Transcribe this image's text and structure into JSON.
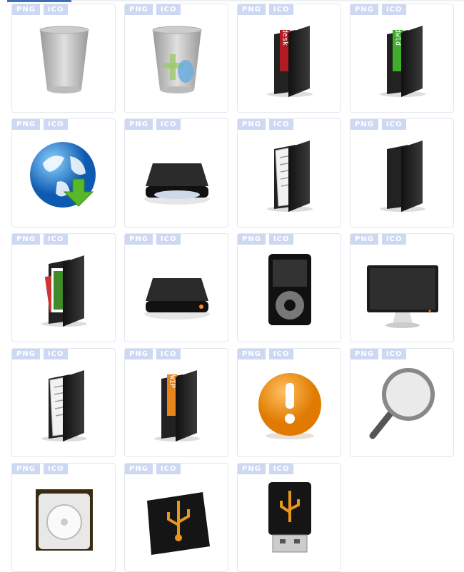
{
  "badges": {
    "png": "PNG",
    "ico": "ICO"
  },
  "icons": [
    {
      "name": "trash-empty-icon"
    },
    {
      "name": "trash-full-icon"
    },
    {
      "name": "folder-desk-icon",
      "label": "desk",
      "color": "#b01c22"
    },
    {
      "name": "folder-dwld-icon",
      "label": "dwld",
      "color": "#3fae2a"
    },
    {
      "name": "globe-download-icon"
    },
    {
      "name": "cd-drive-icon"
    },
    {
      "name": "folder-documents-icon"
    },
    {
      "name": "folder-black-icon"
    },
    {
      "name": "folder-pictures-icon"
    },
    {
      "name": "hard-drive-icon"
    },
    {
      "name": "ipod-icon"
    },
    {
      "name": "monitor-icon"
    },
    {
      "name": "folder-text-icon"
    },
    {
      "name": "folder-wip-icon",
      "label": "WIP",
      "color": "#e8851a"
    },
    {
      "name": "warning-icon"
    },
    {
      "name": "magnifier-icon"
    },
    {
      "name": "speaker-drive-icon"
    },
    {
      "name": "usb-drive-icon"
    },
    {
      "name": "usb-stick-icon"
    }
  ],
  "colors": {
    "badge": "#cdd8f3",
    "accent": "#3b6fb6"
  }
}
